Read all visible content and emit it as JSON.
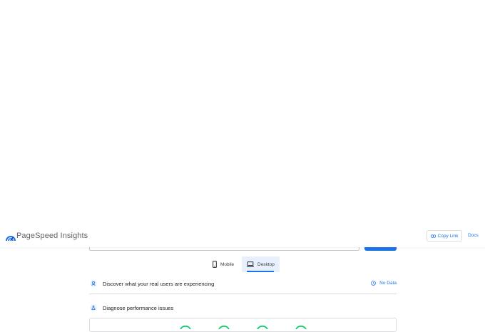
{
  "header": {
    "brand": "PageSpeed Insights",
    "copy_link_label": "Copy Link",
    "docs_label": "Docs"
  },
  "tabs": [
    {
      "label": "Mobile",
      "icon": "phone-icon",
      "selected": false
    },
    {
      "label": "Desktop",
      "icon": "laptop-icon",
      "selected": true
    }
  ],
  "field_data": {
    "title": "Discover what your real users are experiencing",
    "status": "No Data"
  },
  "lab_data": {
    "title": "Diagnose performance issues"
  },
  "colors": {
    "accent": "#1a73e8",
    "good": "#0cce6b",
    "text": "#202124",
    "muted": "#5f6368"
  }
}
